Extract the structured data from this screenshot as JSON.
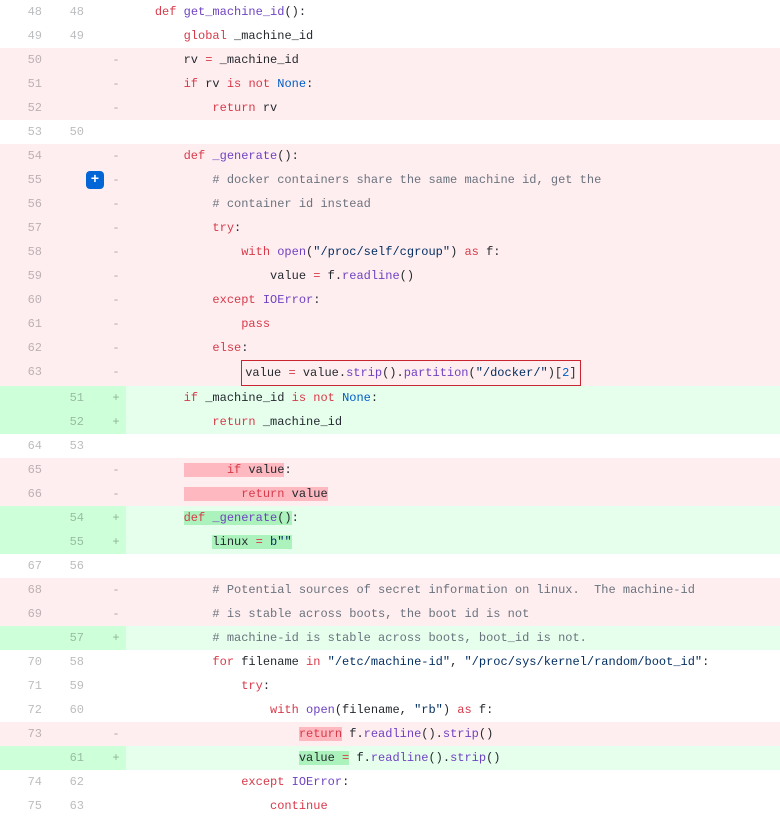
{
  "diff": {
    "lines": [
      {
        "type": "ctx",
        "old": "48",
        "new": "48",
        "tokens": [
          [
            "pl",
            "    "
          ],
          [
            "kw",
            "def"
          ],
          [
            "pl",
            " "
          ],
          [
            "def",
            "get_machine_id"
          ],
          [
            "pl",
            "():"
          ]
        ]
      },
      {
        "type": "ctx",
        "old": "49",
        "new": "49",
        "tokens": [
          [
            "pl",
            "        "
          ],
          [
            "kw",
            "global"
          ],
          [
            "pl",
            " _machine_id"
          ]
        ]
      },
      {
        "type": "del",
        "old": "50",
        "new": "",
        "tokens": [
          [
            "pl",
            "        rv "
          ],
          [
            "kw",
            "="
          ],
          [
            "pl",
            " _machine_id"
          ]
        ]
      },
      {
        "type": "del",
        "old": "51",
        "new": "",
        "tokens": [
          [
            "pl",
            "        "
          ],
          [
            "kw",
            "if"
          ],
          [
            "pl",
            " rv "
          ],
          [
            "kw",
            "is"
          ],
          [
            "pl",
            " "
          ],
          [
            "kw",
            "not"
          ],
          [
            "pl",
            " "
          ],
          [
            "builtin",
            "None"
          ],
          [
            "pl",
            ":"
          ]
        ]
      },
      {
        "type": "del",
        "old": "52",
        "new": "",
        "tokens": [
          [
            "pl",
            "            "
          ],
          [
            "kw",
            "return"
          ],
          [
            "pl",
            " rv"
          ]
        ]
      },
      {
        "type": "ctx",
        "old": "53",
        "new": "50",
        "tokens": []
      },
      {
        "type": "del",
        "old": "54",
        "new": "",
        "tokens": [
          [
            "pl",
            "        "
          ],
          [
            "kw",
            "def"
          ],
          [
            "pl",
            " "
          ],
          [
            "def",
            "_generate"
          ],
          [
            "pl",
            "():"
          ]
        ]
      },
      {
        "type": "del",
        "old": "55",
        "new": "",
        "expand": true,
        "tokens": [
          [
            "pl",
            "            "
          ],
          [
            "com",
            "# docker containers share the same machine id, get the"
          ]
        ]
      },
      {
        "type": "del",
        "old": "56",
        "new": "",
        "tokens": [
          [
            "pl",
            "            "
          ],
          [
            "com",
            "# container id instead"
          ]
        ]
      },
      {
        "type": "del",
        "old": "57",
        "new": "",
        "tokens": [
          [
            "pl",
            "            "
          ],
          [
            "kw",
            "try"
          ],
          [
            "pl",
            ":"
          ]
        ]
      },
      {
        "type": "del",
        "old": "58",
        "new": "",
        "tokens": [
          [
            "pl",
            "                "
          ],
          [
            "kw",
            "with"
          ],
          [
            "pl",
            " "
          ],
          [
            "def",
            "open"
          ],
          [
            "pl",
            "("
          ],
          [
            "str",
            "\"/proc/self/cgroup\""
          ],
          [
            "pl",
            ") "
          ],
          [
            "kw",
            "as"
          ],
          [
            "pl",
            " f:"
          ]
        ]
      },
      {
        "type": "del",
        "old": "59",
        "new": "",
        "tokens": [
          [
            "pl",
            "                    value "
          ],
          [
            "kw",
            "="
          ],
          [
            "pl",
            " f."
          ],
          [
            "def",
            "readline"
          ],
          [
            "pl",
            "()"
          ]
        ]
      },
      {
        "type": "del",
        "old": "60",
        "new": "",
        "tokens": [
          [
            "pl",
            "            "
          ],
          [
            "kw",
            "except"
          ],
          [
            "pl",
            " "
          ],
          [
            "def",
            "IOError"
          ],
          [
            "pl",
            ":"
          ]
        ]
      },
      {
        "type": "del",
        "old": "61",
        "new": "",
        "tokens": [
          [
            "pl",
            "                "
          ],
          [
            "kw",
            "pass"
          ]
        ]
      },
      {
        "type": "del",
        "old": "62",
        "new": "",
        "tokens": [
          [
            "pl",
            "            "
          ],
          [
            "kw",
            "else"
          ],
          [
            "pl",
            ":"
          ]
        ]
      },
      {
        "type": "del",
        "old": "63",
        "new": "",
        "boxed": true,
        "tokens": [
          [
            "pl",
            "                "
          ],
          [
            "box_start",
            ""
          ],
          [
            "pl",
            "value "
          ],
          [
            "kw",
            "="
          ],
          [
            "pl",
            " value."
          ],
          [
            "def",
            "strip"
          ],
          [
            "pl",
            "()."
          ],
          [
            "def",
            "partition"
          ],
          [
            "pl",
            "("
          ],
          [
            "str",
            "\"/docker/\""
          ],
          [
            "pl",
            ")["
          ],
          [
            "num",
            "2"
          ],
          [
            "pl",
            "]"
          ],
          [
            "box_end",
            ""
          ]
        ]
      },
      {
        "type": "add",
        "old": "",
        "new": "51",
        "tokens": [
          [
            "pl",
            "        "
          ],
          [
            "kw",
            "if"
          ],
          [
            "pl",
            " _machine_id "
          ],
          [
            "kw",
            "is"
          ],
          [
            "pl",
            " "
          ],
          [
            "kw",
            "not"
          ],
          [
            "pl",
            " "
          ],
          [
            "builtin",
            "None"
          ],
          [
            "pl",
            ":"
          ]
        ]
      },
      {
        "type": "add",
        "old": "",
        "new": "52",
        "tokens": [
          [
            "pl",
            "            "
          ],
          [
            "kw",
            "return"
          ],
          [
            "pl",
            " _machine_id"
          ]
        ]
      },
      {
        "type": "ctx",
        "old": "64",
        "new": "53",
        "tokens": []
      },
      {
        "type": "del",
        "old": "65",
        "new": "",
        "tokens": [
          [
            "pl",
            "        "
          ],
          [
            "wdel",
            "      "
          ],
          [
            "kw",
            "if"
          ],
          [
            "pl",
            " "
          ],
          [
            "wdel",
            "value"
          ],
          [
            "pl",
            ":"
          ]
        ]
      },
      {
        "type": "del",
        "old": "66",
        "new": "",
        "tokens": [
          [
            "pl",
            "        "
          ],
          [
            "wdel",
            "        "
          ],
          [
            "kw",
            "return"
          ],
          [
            "pl",
            " "
          ],
          [
            "wdel",
            "value"
          ]
        ]
      },
      {
        "type": "add",
        "old": "",
        "new": "54",
        "tokens": [
          [
            "pl",
            "        "
          ],
          [
            "wadd",
            ""
          ],
          [
            "kw",
            "def"
          ],
          [
            "pl",
            " "
          ],
          [
            "def",
            "_generate"
          ],
          [
            "wadd",
            "()"
          ],
          [
            "pl",
            ":"
          ]
        ]
      },
      {
        "type": "add",
        "old": "",
        "new": "55",
        "tokens": [
          [
            "pl",
            "            "
          ],
          [
            "wadd",
            "linux "
          ],
          [
            "kw",
            "="
          ],
          [
            "wadd",
            " "
          ],
          [
            "str",
            "b\"\""
          ]
        ]
      },
      {
        "type": "ctx",
        "old": "67",
        "new": "56",
        "tokens": []
      },
      {
        "type": "del",
        "old": "68",
        "new": "",
        "tokens": [
          [
            "pl",
            "            "
          ],
          [
            "com",
            "# Potential sources of secret information on linux.  The machine-id"
          ]
        ]
      },
      {
        "type": "del",
        "old": "69",
        "new": "",
        "tokens": [
          [
            "pl",
            "            "
          ],
          [
            "com",
            "# is stable across boots, the boot id is not"
          ]
        ]
      },
      {
        "type": "add",
        "old": "",
        "new": "57",
        "tokens": [
          [
            "pl",
            "            "
          ],
          [
            "com",
            "# machine-id is stable across boots, boot_id is not."
          ]
        ]
      },
      {
        "type": "ctx",
        "old": "70",
        "new": "58",
        "tokens": [
          [
            "pl",
            "            "
          ],
          [
            "kw",
            "for"
          ],
          [
            "pl",
            " filename "
          ],
          [
            "kw",
            "in"
          ],
          [
            "pl",
            " "
          ],
          [
            "str",
            "\"/etc/machine-id\""
          ],
          [
            "pl",
            ", "
          ],
          [
            "str",
            "\"/proc/sys/kernel/random/boot_id\""
          ],
          [
            "pl",
            ":"
          ]
        ]
      },
      {
        "type": "ctx",
        "old": "71",
        "new": "59",
        "tokens": [
          [
            "pl",
            "                "
          ],
          [
            "kw",
            "try"
          ],
          [
            "pl",
            ":"
          ]
        ]
      },
      {
        "type": "ctx",
        "old": "72",
        "new": "60",
        "tokens": [
          [
            "pl",
            "                    "
          ],
          [
            "kw",
            "with"
          ],
          [
            "pl",
            " "
          ],
          [
            "def",
            "open"
          ],
          [
            "pl",
            "(filename, "
          ],
          [
            "str",
            "\"rb\""
          ],
          [
            "pl",
            ") "
          ],
          [
            "kw",
            "as"
          ],
          [
            "pl",
            " f:"
          ]
        ]
      },
      {
        "type": "del",
        "old": "73",
        "new": "",
        "tokens": [
          [
            "pl",
            "                        "
          ],
          [
            "wdel_kw",
            "return"
          ],
          [
            "pl",
            " f."
          ],
          [
            "def",
            "readline"
          ],
          [
            "pl",
            "()."
          ],
          [
            "def",
            "strip"
          ],
          [
            "pl",
            "()"
          ]
        ]
      },
      {
        "type": "add",
        "old": "",
        "new": "61",
        "tokens": [
          [
            "pl",
            "                        "
          ],
          [
            "wadd",
            "value "
          ],
          [
            "kw",
            "="
          ],
          [
            "pl",
            " f."
          ],
          [
            "def",
            "readline"
          ],
          [
            "pl",
            "()."
          ],
          [
            "def",
            "strip"
          ],
          [
            "pl",
            "()"
          ]
        ]
      },
      {
        "type": "ctx",
        "old": "74",
        "new": "62",
        "tokens": [
          [
            "pl",
            "                "
          ],
          [
            "kw",
            "except"
          ],
          [
            "pl",
            " "
          ],
          [
            "def",
            "IOError"
          ],
          [
            "pl",
            ":"
          ]
        ]
      },
      {
        "type": "ctx",
        "old": "75",
        "new": "63",
        "tokens": [
          [
            "pl",
            "                    "
          ],
          [
            "kw",
            "continue"
          ]
        ]
      }
    ]
  },
  "icons": {
    "expand_plus": "+"
  },
  "markers": {
    "del": "-",
    "add": "+"
  }
}
